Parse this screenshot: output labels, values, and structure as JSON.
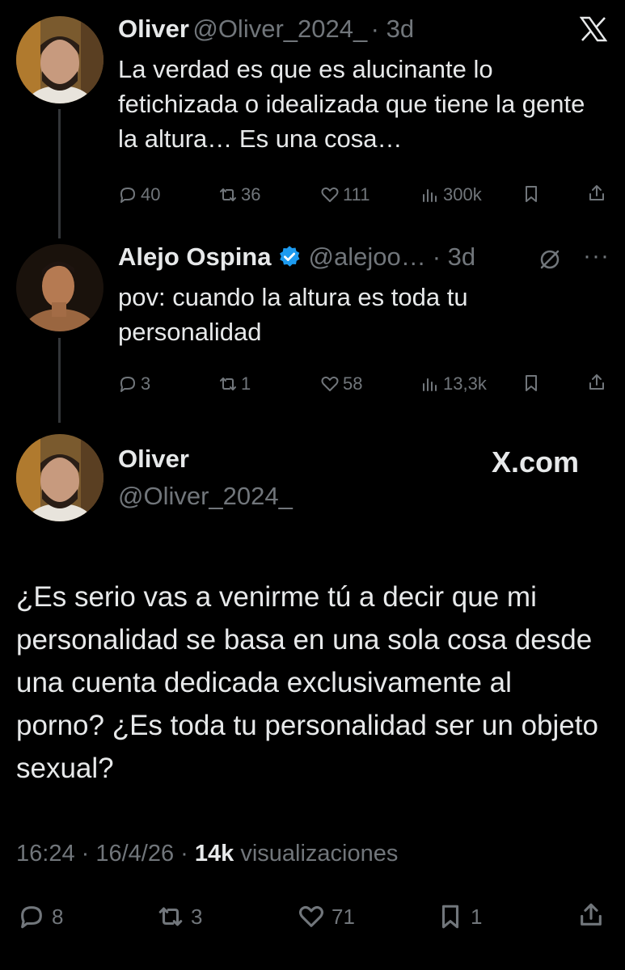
{
  "brand": {
    "x_icon": "x-logo-icon",
    "watermark": "X.com"
  },
  "tweet1": {
    "name": "Oliver",
    "handle": "@Oliver_2024_",
    "time": "· 3d",
    "text": "La verdad es que es alucinante lo fetichizada o idealizada que tiene la gente la altura… Es una cosa…",
    "replies": "40",
    "retweets": "36",
    "likes": "111",
    "views": "300k"
  },
  "tweet2": {
    "name": "Alejo Ospina",
    "handle": "@alejoo…",
    "time": "· 3d",
    "verified_color": "#1d9bf0",
    "text": "pov: cuando la altura es toda tu personalidad",
    "replies": "3",
    "retweets": "1",
    "likes": "58",
    "views": "13,3k"
  },
  "main": {
    "name": "Oliver",
    "handle": "@Oliver_2024_",
    "text": "¿Es serio vas a venirme tú a decir que mi personalidad se basa en una sola cosa desde una cuenta dedicada exclusivamente al porno? ¿Es toda tu personalidad ser un objeto sexual?",
    "time": "16:24 · 16/4/26 ·",
    "views_count": "14k",
    "views_label": "visualizaciones",
    "replies": "8",
    "retweets": "3",
    "likes": "71",
    "bookmarks": "1"
  }
}
